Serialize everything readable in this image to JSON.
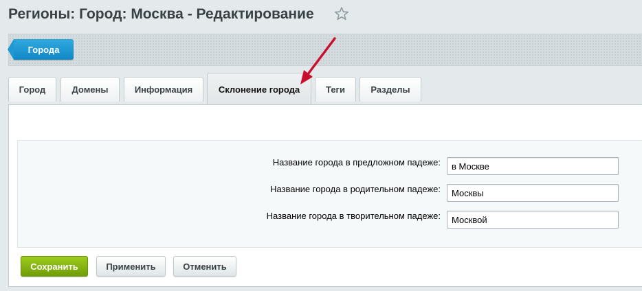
{
  "page": {
    "title": "Регионы: Город: Москва - Редактирование",
    "star_icon": "star-icon"
  },
  "toolbar": {
    "back_button": "Города"
  },
  "tabs": [
    {
      "label": "Город",
      "active": false
    },
    {
      "label": "Домены",
      "active": false
    },
    {
      "label": "Информация",
      "active": false
    },
    {
      "label": "Склонение города",
      "active": true
    },
    {
      "label": "Теги",
      "active": false
    },
    {
      "label": "Разделы",
      "active": false
    }
  ],
  "form": {
    "fields": [
      {
        "label": "Название города в предложном падеже:",
        "value": "в Москве"
      },
      {
        "label": "Название города в родительном падеже:",
        "value": "Москвы"
      },
      {
        "label": "Название города в творительном падеже:",
        "value": "Москвой"
      }
    ]
  },
  "buttons": {
    "save": "Сохранить",
    "apply": "Применить",
    "cancel": "Отменить"
  },
  "colors": {
    "accent_blue": "#1e99d4",
    "save_green": "#80ad0e",
    "annotation_arrow": "#c8102e"
  }
}
